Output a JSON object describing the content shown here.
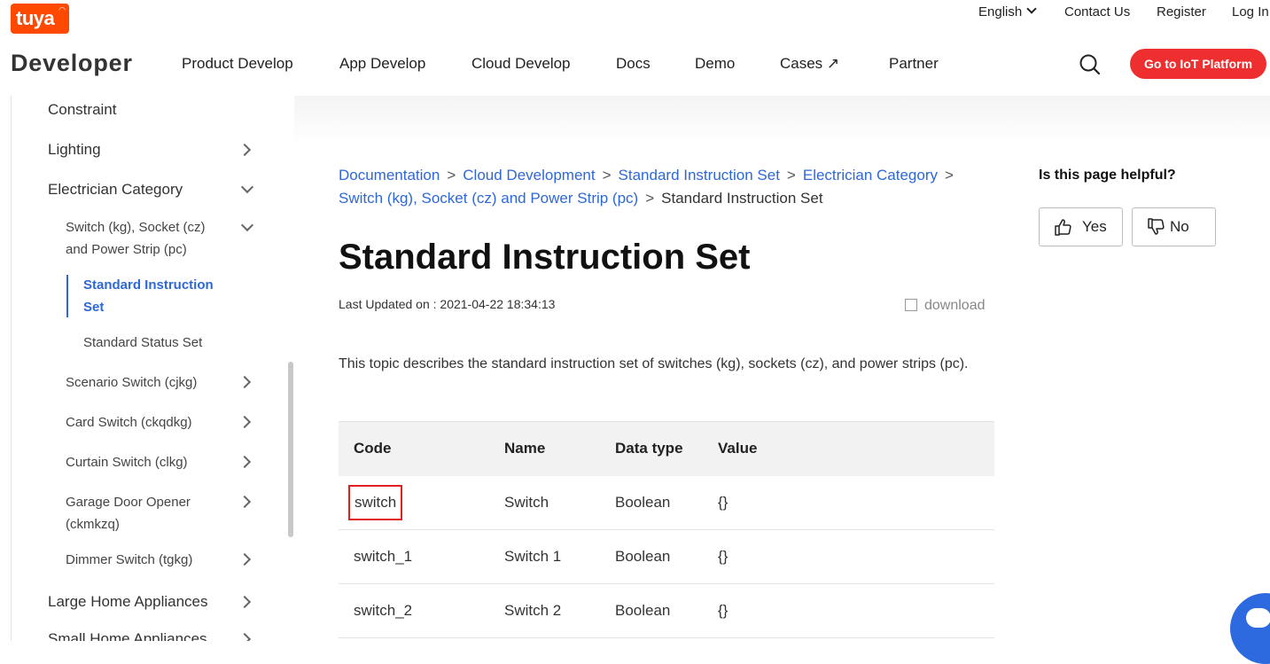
{
  "header": {
    "brand": "tuya",
    "product": "Developer",
    "language": "English",
    "contact": "Contact Us",
    "register": "Register",
    "login": "Log In",
    "nav": [
      "Product Develop",
      "App Develop",
      "Cloud Develop",
      "Docs",
      "Demo",
      "Cases ↗",
      "Partner"
    ],
    "cta": "Go to IoT Platform",
    "cta_color": "#ef2f2f"
  },
  "sidebar": {
    "items": {
      "constraint": "Constraint",
      "lighting": "Lighting",
      "electrician": "Electrician Category",
      "switch_group": "Switch (kg), Socket (cz) and Power Strip (pc)",
      "standard_instruction": "Standard Instruction Set",
      "standard_status": "Standard Status Set",
      "scenario": "Scenario Switch (cjkg)",
      "card": "Card Switch (ckqdkg)",
      "curtain": "Curtain Switch (clkg)",
      "garage": "Garage Door Opener (ckmkzq)",
      "dimmer": "Dimmer Switch (tgkg)",
      "large": "Large Home Appliances",
      "small": "Small Home Appliances"
    },
    "active_color": "#2e68d8"
  },
  "breadcrumb": [
    "Documentation",
    "Cloud Development",
    "Standard Instruction Set",
    "Electrician Category",
    "Switch (kg), Socket (cz) and Power Strip (pc)",
    "Standard Instruction Set"
  ],
  "page": {
    "title": "Standard Instruction Set",
    "updated": "Last Updated on : 2021-04-22 18:34:13",
    "download": "download",
    "description": "This topic describes the standard instruction set of switches (kg), sockets (cz), and power strips (pc)."
  },
  "table": {
    "headers": [
      "Code",
      "Name",
      "Data type",
      "Value"
    ],
    "rows": [
      [
        "switch",
        "Switch",
        "Boolean",
        "{}"
      ],
      [
        "switch_1",
        "Switch 1",
        "Boolean",
        "{}"
      ],
      [
        "switch_2",
        "Switch 2",
        "Boolean",
        "{}"
      ]
    ]
  },
  "feedback": {
    "question": "Is this page helpful?",
    "yes": "Yes",
    "no": "No"
  }
}
